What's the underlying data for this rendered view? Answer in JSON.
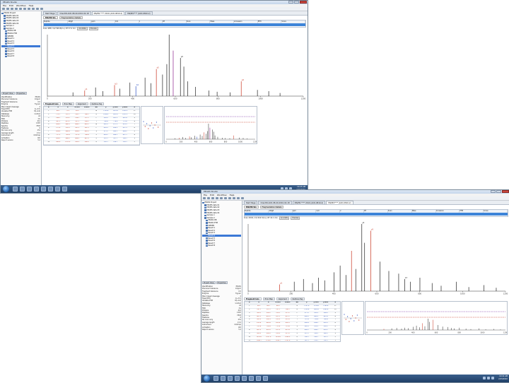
{
  "screenshots": [
    {
      "id": "shot1",
      "window_title": "PEAKS Studio",
      "menu": [
        "File",
        "Edit",
        "Workflow",
        "Help"
      ],
      "doc_tabs": [
        "Start Page",
        "ClientID-ACD-08-40-2010-02-18",
        "MS/MS **** 2010 (ACD-0810-2)",
        "MS/MS**** (ACD-0810-2)"
      ],
      "sub_tabs": [
        "MS/MS Vis",
        "Fragmentation Details"
      ],
      "header_columns": [
        "Peptide",
        "-10lgP",
        "ppm",
        "m/z",
        "z",
        "RT",
        "Scan",
        "Mass",
        "Accession",
        "PTM",
        "Score"
      ],
      "header_row": [
        "",
        "",
        "",
        "",
        "",
        "",
        "",
        "",
        "",
        "",
        ""
      ],
      "spectrum_info": "Scan #88, m/z 590.8(2+), RT 37.4 min",
      "spectrum_buttons": [
        "Annotate",
        "Preview"
      ],
      "bottom_tabs": [
        "Fragment Ions",
        "Error Map",
        "Alignment",
        "De Novo Tag"
      ],
      "tree_items": [
        "PEAKS Project",
        "MS/MS data 01",
        "MS/MS data 02",
        "MS/MS data 03",
        "MS/MS data 04",
        "Sample 1",
        "Sample 2",
        "PEAKS DB",
        "PEAKS PTM",
        "SPIDER",
        "Result 1",
        "Result 2",
        "Result 3",
        "Result 4",
        "Result 5",
        "Result 6",
        "Result 7",
        "Result 8"
      ],
      "left_tabs": [
        "Project View",
        "Properties"
      ],
      "props": [
        {
          "k": "Identification",
          "v": "PEAKS"
        },
        {
          "k": "Precursor tolerance",
          "v": "10ppm"
        },
        {
          "k": "Fragment tolerance",
          "v": "0.5"
        },
        {
          "k": "Enzyme",
          "v": "Trypsin"
        },
        {
          "k": "Max missed cleavage",
          "v": "2"
        },
        {
          "k": "Fixed PTM",
          "v": "C(+57)"
        },
        {
          "k": "Variable PTM",
          "v": "M(+16)"
        },
        {
          "k": "Database",
          "v": "UniProt"
        },
        {
          "k": "Taxonomy",
          "v": "All"
        },
        {
          "k": "FDR",
          "v": "1%"
        },
        {
          "k": "Proteins",
          "v": "412"
        },
        {
          "k": "Peptides",
          "v": "1587"
        },
        {
          "k": "Spectra",
          "v": "7803"
        },
        {
          "k": "Features",
          "v": "0"
        },
        {
          "k": "De novo only",
          "v": "251"
        },
        {
          "k": "Average length",
          "v": "13.2"
        },
        {
          "k": "Instrument",
          "v": "Orbitrap"
        },
        {
          "k": "Activation",
          "v": "CID"
        },
        {
          "k": "Report version",
          "v": "5.2"
        }
      ],
      "frag_columns": [
        "#",
        "a",
        "b",
        "b-H2O",
        "b-NH3",
        "AA",
        "y",
        "y-H2O",
        "y-NH3",
        "#"
      ],
      "frag_rows": [
        [
          "1",
          "44.1",
          "72.0",
          "54.0",
          "",
          "A",
          "1109.6",
          "1091.6",
          "1092.5",
          "11"
        ],
        [
          "2",
          "173.1",
          "201.1",
          "183.1",
          "184.1",
          "E",
          "1038.5",
          "1020.5",
          "1021.5",
          "10"
        ],
        [
          "3",
          "286.2",
          "314.2",
          "296.2",
          "297.2",
          "L",
          "909.5",
          "891.5",
          "892.4",
          "9"
        ],
        [
          "4",
          "387.2",
          "415.2",
          "397.2",
          "398.2",
          "T",
          "796.4",
          "778.4",
          "779.4",
          "8"
        ],
        [
          "5",
          "458.3",
          "486.3",
          "468.3",
          "469.2",
          "A",
          "695.3",
          "677.3",
          "678.3",
          "7"
        ],
        [
          "6",
          "571.4",
          "599.3",
          "581.3",
          "582.3",
          "L",
          "624.3",
          "606.3",
          "607.3",
          "6"
        ],
        [
          "7",
          "658.4",
          "686.4",
          "668.4",
          "669.3",
          "S",
          "511.2",
          "493.2",
          "494.2",
          "5"
        ],
        [
          "8",
          "757.5",
          "785.4",
          "767.4",
          "768.4",
          "V",
          "424.2",
          "406.2",
          "407.1",
          "4"
        ],
        [
          "9",
          "856.5",
          "884.5",
          "866.5",
          "867.5",
          "V",
          "325.1",
          "307.1",
          "308.1",
          "3"
        ],
        [
          "10",
          "985.6",
          "1013.5",
          "995.5",
          "996.5",
          "E",
          "226.1",
          "208.1",
          "209.1",
          "2"
        ],
        [
          "11",
          "1142.7",
          "1170.6",
          "1152.6",
          "1153.6",
          "R",
          "175.1",
          "157.1",
          "158.1",
          "1"
        ],
        [
          "12",
          "",
          "",
          "",
          "",
          "",
          "",
          "",
          "",
          ""
        ]
      ],
      "peaks": [
        {
          "mz": 120,
          "int": 6,
          "c": "#222222"
        },
        {
          "mz": 175,
          "int": 9,
          "c": "#c7321f",
          "lab": "y1"
        },
        {
          "mz": 226,
          "int": 14,
          "c": "#222222"
        },
        {
          "mz": 260,
          "int": 8,
          "c": "#222222"
        },
        {
          "mz": 315,
          "int": 18,
          "c": "#c7321f",
          "lab": "b3"
        },
        {
          "mz": 340,
          "int": 12,
          "c": "#222222"
        },
        {
          "mz": 387,
          "int": 22,
          "c": "#222222"
        },
        {
          "mz": 415,
          "int": 16,
          "c": "#2a4fc2",
          "lab": "b4"
        },
        {
          "mz": 458,
          "int": 30,
          "c": "#222222"
        },
        {
          "mz": 486,
          "int": 21,
          "c": "#222222"
        },
        {
          "mz": 511,
          "int": 44,
          "c": "#c7321f",
          "lab": "y5"
        },
        {
          "mz": 540,
          "int": 35,
          "c": "#222222"
        },
        {
          "mz": 560,
          "int": 52,
          "c": "#222222"
        },
        {
          "mz": 571,
          "int": 100,
          "c": "#222222"
        },
        {
          "mz": 590,
          "int": 74,
          "c": "#8a1f8a"
        },
        {
          "mz": 624,
          "int": 62,
          "c": "#222222",
          "lab": "y6"
        },
        {
          "mz": 640,
          "int": 48,
          "c": "#222222"
        },
        {
          "mz": 658,
          "int": 24,
          "c": "#222222"
        },
        {
          "mz": 695,
          "int": 15,
          "c": "#222222"
        },
        {
          "mz": 757,
          "int": 9,
          "c": "#222222"
        },
        {
          "mz": 796,
          "int": 7,
          "c": "#222222"
        },
        {
          "mz": 857,
          "int": 6,
          "c": "#222222"
        },
        {
          "mz": 909,
          "int": 24,
          "c": "#c7321f",
          "lab": "y9"
        },
        {
          "mz": 985,
          "int": 10,
          "c": "#222222"
        },
        {
          "mz": 1038,
          "int": 8,
          "c": "#222222"
        },
        {
          "mz": 1091,
          "int": 5,
          "c": "#222222"
        }
      ],
      "x_ticks": [
        "0",
        "200",
        "400",
        "600",
        "800",
        "1000",
        "1200"
      ],
      "time": "10:23 AM",
      "date": "2/15/2010"
    },
    {
      "id": "shot2",
      "window_title": "PEAKS Studio",
      "menu": [
        "File",
        "Edit",
        "Workflow",
        "Help"
      ],
      "doc_tabs": [
        "Start Page",
        "ClientID-ACD-08-40-2010-02-18",
        "MS/MS **** 2010 (ACD-0810-2)",
        "MS/MS**** (ACD-0810-2)"
      ],
      "sub_tabs": [
        "MS/MS Vis",
        "Fragmentation Details"
      ],
      "header_columns": [
        "Peptide",
        "-10lgP",
        "ppm",
        "m/z",
        "z",
        "RT",
        "Scan",
        "Mass",
        "Accession",
        "PTM",
        "Score"
      ],
      "header_row": [
        "",
        "",
        "",
        "",
        "",
        "",
        "",
        "",
        "",
        "",
        ""
      ],
      "spectrum_info": "Scan #102, m/z 622.3(2+), RT 41.1 min",
      "spectrum_buttons": [
        "Annotate",
        "Preview"
      ],
      "bottom_tabs": [
        "Fragment Ions",
        "Error Map",
        "Alignment",
        "De Novo Tag"
      ],
      "tree_items": [
        "PEAKS Project",
        "MS/MS data 01",
        "MS/MS data 02",
        "MS/MS data 03",
        "MS/MS data 04",
        "Sample 1",
        "Sample 2",
        "PEAKS DB",
        "PEAKS PTM",
        "SPIDER",
        "Result 1",
        "Result 2",
        "Result 3",
        "Result 4",
        "Result 5",
        "Result 6",
        "Result 7",
        "Result 8"
      ],
      "left_tabs": [
        "Project View",
        "Properties"
      ],
      "props": [
        {
          "k": "Identification",
          "v": "PEAKS"
        },
        {
          "k": "Precursor tolerance",
          "v": "10ppm"
        },
        {
          "k": "Fragment tolerance",
          "v": "0.5"
        },
        {
          "k": "Enzyme",
          "v": "Trypsin"
        },
        {
          "k": "Max missed cleavage",
          "v": "2"
        },
        {
          "k": "Fixed PTM",
          "v": "C(+57)"
        },
        {
          "k": "Variable PTM",
          "v": "M(+16)"
        },
        {
          "k": "Database",
          "v": "UniProt"
        },
        {
          "k": "Taxonomy",
          "v": "All"
        },
        {
          "k": "FDR",
          "v": "1%"
        },
        {
          "k": "Proteins",
          "v": "412"
        },
        {
          "k": "Peptides",
          "v": "1587"
        },
        {
          "k": "Spectra",
          "v": "7803"
        },
        {
          "k": "Features",
          "v": "0"
        },
        {
          "k": "De novo only",
          "v": "251"
        },
        {
          "k": "Average length",
          "v": "13.2"
        },
        {
          "k": "Instrument",
          "v": "Orbitrap"
        },
        {
          "k": "Activation",
          "v": "CID"
        },
        {
          "k": "Report version",
          "v": "5.2"
        }
      ],
      "frag_columns": [
        "#",
        "a",
        "b",
        "b-H2O",
        "b-NH3",
        "AA",
        "y",
        "y-H2O",
        "y-NH3",
        "#"
      ],
      "frag_rows": [
        [
          "1",
          "58.1",
          "86.1",
          "68.0",
          "",
          "G",
          "1157.6",
          "1139.6",
          "1140.6",
          "11"
        ],
        [
          "2",
          "187.1",
          "215.1",
          "197.1",
          "198.1",
          "E",
          "1100.6",
          "1082.6",
          "1083.6",
          "10"
        ],
        [
          "3",
          "300.2",
          "328.2",
          "310.2",
          "311.2",
          "L",
          "971.5",
          "953.5",
          "954.5",
          "9"
        ],
        [
          "4",
          "401.2",
          "429.2",
          "411.2",
          "412.2",
          "T",
          "858.5",
          "840.5",
          "841.4",
          "8"
        ],
        [
          "5",
          "502.3",
          "530.3",
          "512.3",
          "513.3",
          "T",
          "757.4",
          "739.4",
          "740.4",
          "7"
        ],
        [
          "6",
          "615.4",
          "643.4",
          "625.4",
          "626.3",
          "L",
          "656.4",
          "638.3",
          "639.3",
          "6"
        ],
        [
          "7",
          "702.4",
          "730.4",
          "712.4",
          "713.4",
          "S",
          "543.3",
          "525.3",
          "526.2",
          "5"
        ],
        [
          "8",
          "801.5",
          "829.5",
          "811.5",
          "812.4",
          "V",
          "456.2",
          "438.2",
          "439.2",
          "4"
        ],
        [
          "9",
          "900.5",
          "928.5",
          "910.5",
          "911.5",
          "V",
          "357.2",
          "339.2",
          "340.2",
          "3"
        ],
        [
          "10",
          "1029.6",
          "1057.6",
          "1039.6",
          "1040.5",
          "E",
          "258.1",
          "240.1",
          "241.1",
          "2"
        ],
        [
          "11",
          "1186.7",
          "1214.7",
          "1196.7",
          "1197.6",
          "K",
          "147.1",
          "129.1",
          "130.1",
          "1"
        ],
        [
          "12",
          "",
          "",
          "",
          "",
          "",
          "",
          "",
          "",
          ""
        ]
      ],
      "peaks": [
        {
          "mz": 147,
          "int": 10,
          "c": "#c7321f",
          "lab": "y1"
        },
        {
          "mz": 215,
          "int": 14,
          "c": "#222222"
        },
        {
          "mz": 258,
          "int": 18,
          "c": "#222222"
        },
        {
          "mz": 300,
          "int": 12,
          "c": "#222222"
        },
        {
          "mz": 328,
          "int": 20,
          "c": "#222222"
        },
        {
          "mz": 357,
          "int": 16,
          "c": "#222222"
        },
        {
          "mz": 401,
          "int": 28,
          "c": "#222222"
        },
        {
          "mz": 429,
          "int": 38,
          "c": "#222222"
        },
        {
          "mz": 456,
          "int": 24,
          "c": "#222222"
        },
        {
          "mz": 482,
          "int": 60,
          "c": "#c7321f"
        },
        {
          "mz": 502,
          "int": 33,
          "c": "#222222"
        },
        {
          "mz": 530,
          "int": 100,
          "c": "#222222",
          "lab": "y4"
        },
        {
          "mz": 543,
          "int": 72,
          "c": "#222222"
        },
        {
          "mz": 572,
          "int": 90,
          "c": "#c7321f",
          "lab": "y5"
        },
        {
          "mz": 615,
          "int": 44,
          "c": "#222222"
        },
        {
          "mz": 656,
          "int": 30,
          "c": "#222222"
        },
        {
          "mz": 702,
          "int": 26,
          "c": "#222222"
        },
        {
          "mz": 730,
          "int": 18,
          "c": "#222222",
          "lab": "b7"
        },
        {
          "mz": 757,
          "int": 14,
          "c": "#222222"
        },
        {
          "mz": 801,
          "int": 20,
          "c": "#222222"
        },
        {
          "mz": 858,
          "int": 12,
          "c": "#222222"
        },
        {
          "mz": 900,
          "int": 8,
          "c": "#222222"
        },
        {
          "mz": 971,
          "int": 14,
          "c": "#222222"
        },
        {
          "mz": 1029,
          "int": 6,
          "c": "#222222"
        },
        {
          "mz": 1100,
          "int": 9,
          "c": "#222222"
        },
        {
          "mz": 1157,
          "int": 5,
          "c": "#222222"
        }
      ],
      "x_ticks": [
        "0",
        "200",
        "400",
        "600",
        "800",
        "1000",
        "1200"
      ],
      "time": "10:41 AM",
      "date": "2/15/2010"
    }
  ]
}
